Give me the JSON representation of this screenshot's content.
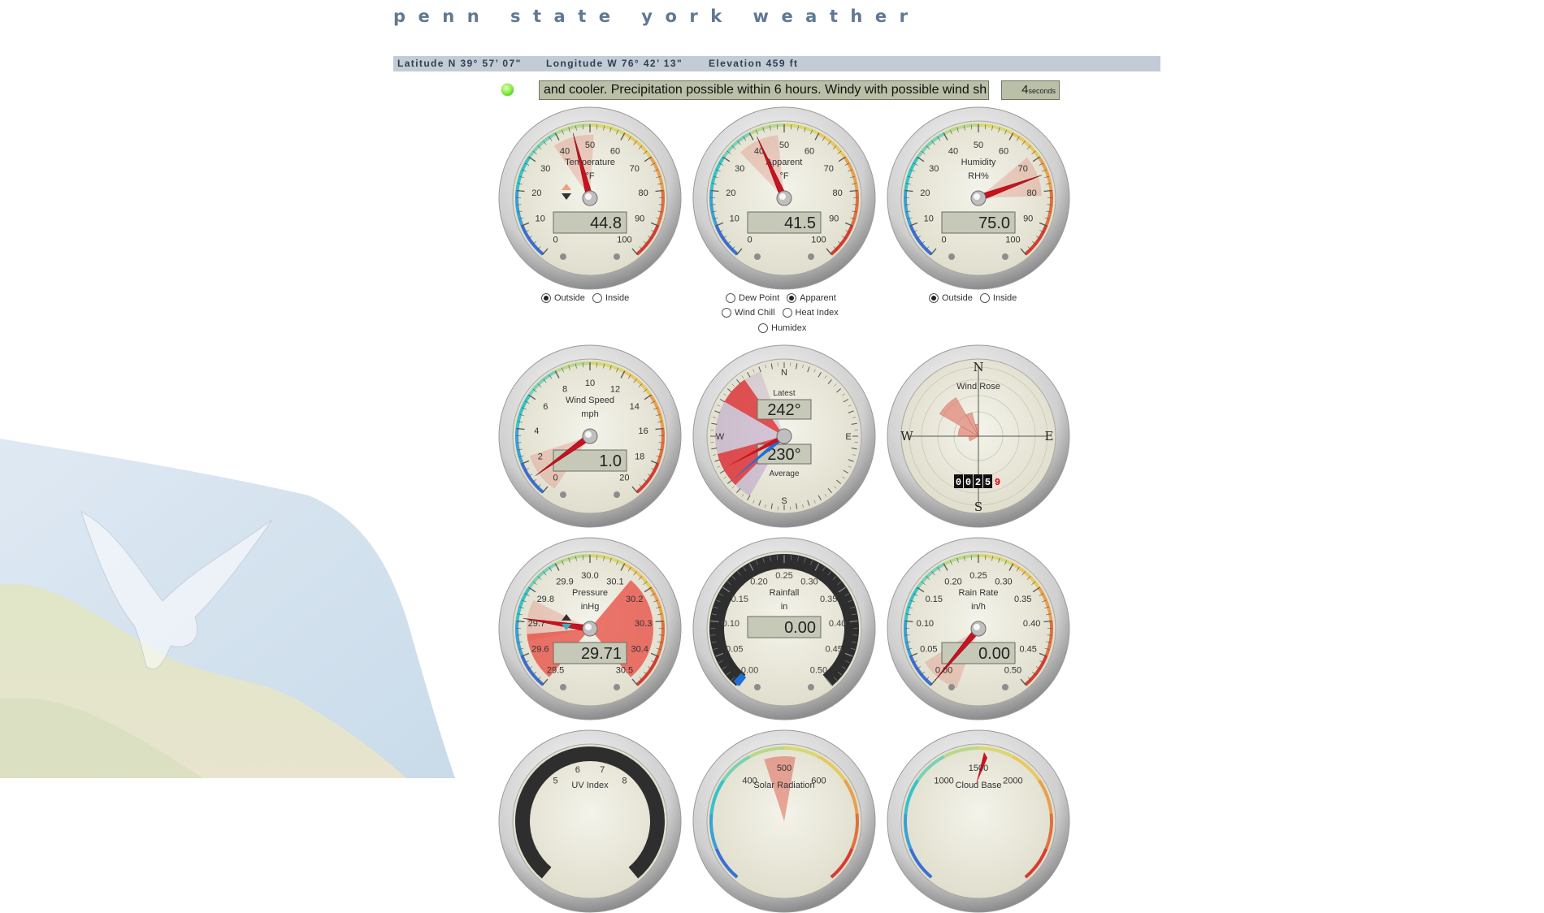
{
  "site": {
    "title": "penn state york weather",
    "latitude": "Latitude N 39° 57’ 07\"",
    "longitude": "Longitude W 76° 42’ 13\"",
    "elevation": "Elevation 459 ft"
  },
  "status": {
    "forecast": "and cooler. Precipitation possible within 6 hours. Windy with possible wind sh",
    "countdown": "4",
    "countdown_unit": "seconds"
  },
  "colors": {
    "accent": "#5f7893",
    "needle": "#c8121f",
    "bar": "#c3ccd6",
    "lcd": "#c7c9b8"
  },
  "gauges": {
    "temperature": {
      "title": "Temperature",
      "unit": "°F",
      "value": "44.8",
      "min": 0,
      "max": 100,
      "reading": 44.8,
      "trend": "falling",
      "ticks": [
        "0",
        "10",
        "20",
        "30",
        "40",
        "50",
        "60",
        "70",
        "80",
        "90",
        "100"
      ]
    },
    "apparent": {
      "title": "Apparent",
      "unit": "°F",
      "value": "41.5",
      "min": 0,
      "max": 100,
      "reading": 41.5,
      "ticks": [
        "0",
        "10",
        "20",
        "30",
        "40",
        "50",
        "60",
        "70",
        "80",
        "90",
        "100"
      ]
    },
    "humidity": {
      "title": "Humidity",
      "unit": "RH%",
      "value": "75.0",
      "min": 0,
      "max": 100,
      "reading": 75.0,
      "ticks": [
        "0",
        "10",
        "20",
        "30",
        "40",
        "50",
        "60",
        "70",
        "80",
        "90",
        "100"
      ]
    },
    "wind_speed": {
      "title": "Wind Speed",
      "unit": "mph",
      "value": "1.0",
      "min": 0,
      "max": 20,
      "reading": 1.0,
      "ticks": [
        "0",
        "2",
        "4",
        "6",
        "8",
        "10",
        "12",
        "14",
        "16",
        "18",
        "20"
      ]
    },
    "wind_direction": {
      "latest_label": "Latest",
      "latest": "242°",
      "average_label": "Average",
      "average": "230°",
      "latest_deg": 242,
      "average_deg": 230
    },
    "wind_rose": {
      "title": "Wind Rose",
      "odometer": [
        "0",
        "0",
        "2",
        "5",
        "9"
      ],
      "n": "N",
      "s": "S",
      "e": "E",
      "w": "W"
    },
    "pressure": {
      "title": "Pressure",
      "unit": "inHg",
      "value": "29.71",
      "min": 29.5,
      "max": 30.5,
      "reading": 29.71,
      "trend": "rising",
      "ticks": [
        "29.5",
        "29.6",
        "29.7",
        "29.8",
        "29.9",
        "30.0",
        "30.1",
        "30.2",
        "30.3",
        "30.4",
        "30.5"
      ]
    },
    "rainfall": {
      "title": "Rainfall",
      "unit": "in",
      "value": "0.00",
      "min": 0,
      "max": 0.5,
      "reading": 0,
      "ticks": [
        "0.00",
        "0.05",
        "0.10",
        "0.15",
        "0.20",
        "0.25",
        "0.30",
        "0.35",
        "0.40",
        "0.45",
        "0.50"
      ]
    },
    "rain_rate": {
      "title": "Rain Rate",
      "unit": "in/h",
      "value": "0.00",
      "min": 0,
      "max": 0.5,
      "reading": 0,
      "ticks": [
        "0.00",
        "0.05",
        "0.10",
        "0.15",
        "0.20",
        "0.25",
        "0.30",
        "0.35",
        "0.40",
        "0.45",
        "0.50"
      ]
    },
    "uv": {
      "title": "UV Index",
      "ticks": [
        "5",
        "6",
        "7",
        "8"
      ]
    },
    "solar": {
      "title": "Solar Radiation",
      "ticks": [
        "400",
        "500",
        "600"
      ]
    },
    "cloud": {
      "title": "Cloud Base",
      "ticks": [
        "1000",
        "1500",
        "2000"
      ]
    }
  },
  "options": {
    "temperature": [
      {
        "label": "Outside",
        "checked": true
      },
      {
        "label": "Inside",
        "checked": false
      }
    ],
    "apparent_row1": [
      {
        "label": "Dew Point",
        "checked": false
      },
      {
        "label": "Apparent",
        "checked": true
      }
    ],
    "apparent_row2": [
      {
        "label": "Wind Chill",
        "checked": false
      },
      {
        "label": "Heat Index",
        "checked": false
      }
    ],
    "apparent_row3": [
      {
        "label": "Humidex",
        "checked": false
      }
    ],
    "humidity": [
      {
        "label": "Outside",
        "checked": true
      },
      {
        "label": "Inside",
        "checked": false
      }
    ]
  }
}
